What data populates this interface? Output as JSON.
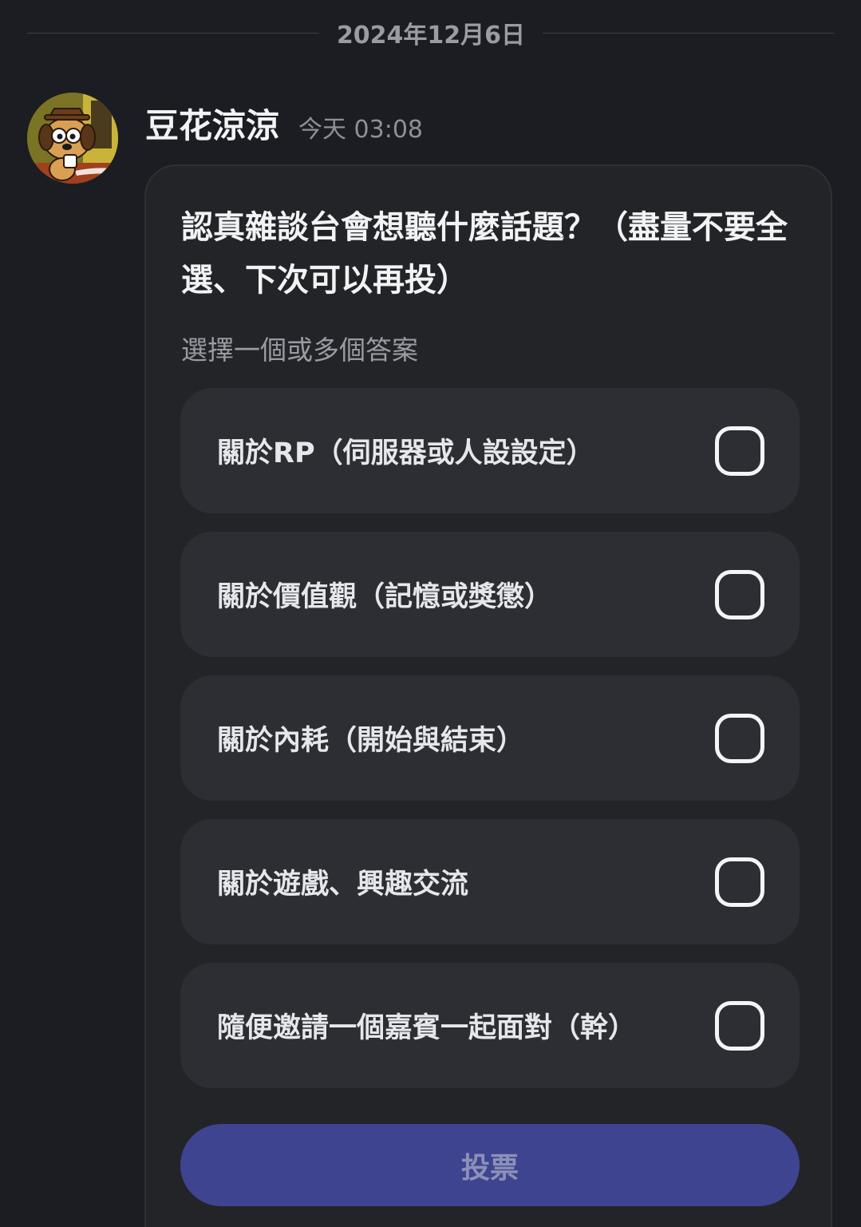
{
  "date_divider": "2024年12月6日",
  "message": {
    "username": "豆花涼涼",
    "timestamp": "今天 03:08"
  },
  "poll": {
    "question": "認真雜談台會想聽什麼話題？（盡量不要全選、下次可以再投）",
    "subtitle": "選擇一個或多個答案",
    "options": [
      {
        "label": "關於RP（伺服器或人設設定）",
        "checked": false
      },
      {
        "label": "關於價值觀（記憶或獎懲）",
        "checked": false
      },
      {
        "label": "關於內耗（開始與結束）",
        "checked": false
      },
      {
        "label": "關於遊戲、興趣交流",
        "checked": false
      },
      {
        "label": "隨便邀請一個嘉賓一起面對（幹）",
        "checked": false
      }
    ],
    "vote_label": "投票"
  },
  "colors": {
    "background": "#1c1d22",
    "card": "#232428",
    "option": "#2d2e34",
    "vote_button": "#3f4491"
  },
  "icons": {
    "avatar": "cartoon-dog-avatar",
    "checkbox": "empty-checkbox"
  }
}
